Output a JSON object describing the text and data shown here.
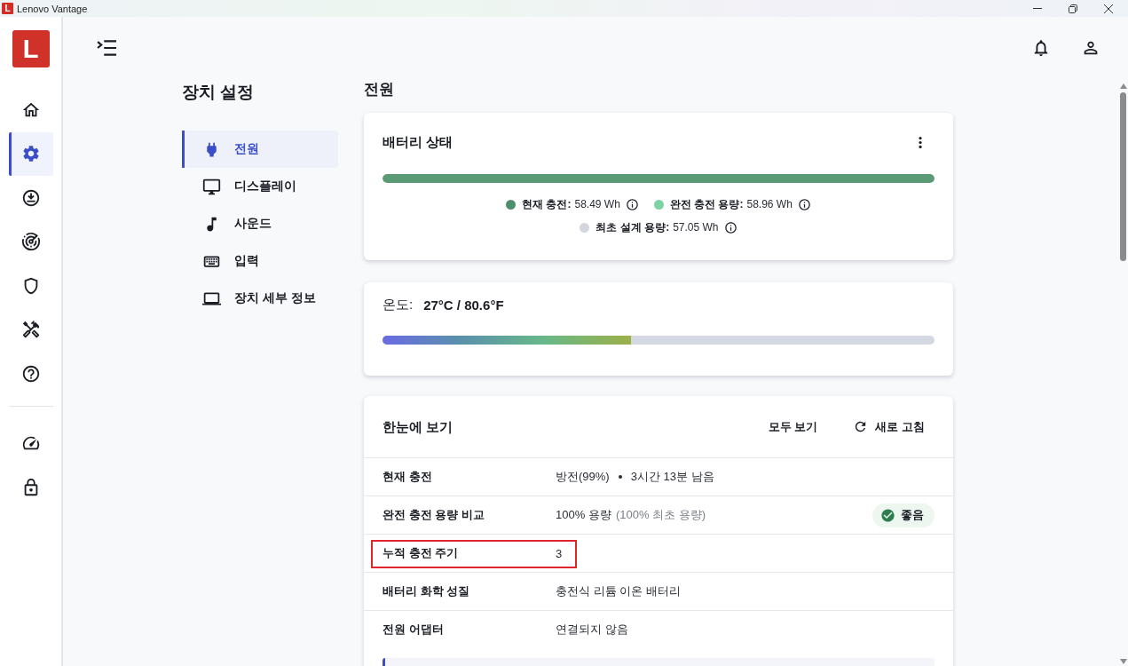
{
  "window": {
    "logo": "L",
    "title": "Lenovo Vantage"
  },
  "rail": {
    "logo": "L",
    "items": [
      {
        "selected": false
      },
      {
        "selected": true
      },
      {
        "selected": false
      },
      {
        "selected": false
      },
      {
        "selected": false
      },
      {
        "selected": false
      },
      {
        "selected": false
      }
    ],
    "bottom_items": [
      {
        "selected": false
      },
      {
        "selected": false
      }
    ]
  },
  "settings_nav": {
    "title": "장치 설정",
    "items": [
      {
        "label": "전원",
        "selected": true
      },
      {
        "label": "디스플레이",
        "selected": false
      },
      {
        "label": "사운드",
        "selected": false
      },
      {
        "label": "입력",
        "selected": false
      },
      {
        "label": "장치 세부 정보",
        "selected": false
      }
    ]
  },
  "page": {
    "title": "전원"
  },
  "battery_card": {
    "title": "배터리 상태",
    "level": 1,
    "legend_rows": [
      {
        "items": [
          {
            "label": "현재 충전:",
            "value": "58.49 Wh",
            "color": "#4e8f6b"
          },
          {
            "label": "완전 충전 용량:",
            "value": "58.96 Wh",
            "color": "#7dd3a3"
          }
        ]
      },
      {
        "items": [
          {
            "label": "최초 설계 용량:",
            "value": "57.05 Wh",
            "color": "#d3d6de"
          }
        ]
      }
    ]
  },
  "temperature_card": {
    "label": "온도:",
    "value": "27°C / 80.6°F",
    "level": 0.45
  },
  "glance_card": {
    "title": "한눈에 보기",
    "view_all": "모두 보기",
    "refresh": "새로 고침",
    "rows": [
      {
        "label": "현재 충전",
        "value": "방전(99%)",
        "detail": "3시간 13분 남음",
        "highlighted": false
      },
      {
        "label": "완전 충전 용량 비교",
        "value": "100% 용량",
        "hint": "(100% 최초 용량)",
        "badge": {
          "label": "좋음"
        },
        "highlighted": false
      },
      {
        "label": "누적 충전 주기",
        "value": "3",
        "highlighted": true
      },
      {
        "label": "배터리 화학 성질",
        "value": "충전식 리튬 이온 배터리",
        "highlighted": false
      },
      {
        "label": "전원 어댑터",
        "value": "연결되지 않음",
        "highlighted": false
      }
    ]
  }
}
